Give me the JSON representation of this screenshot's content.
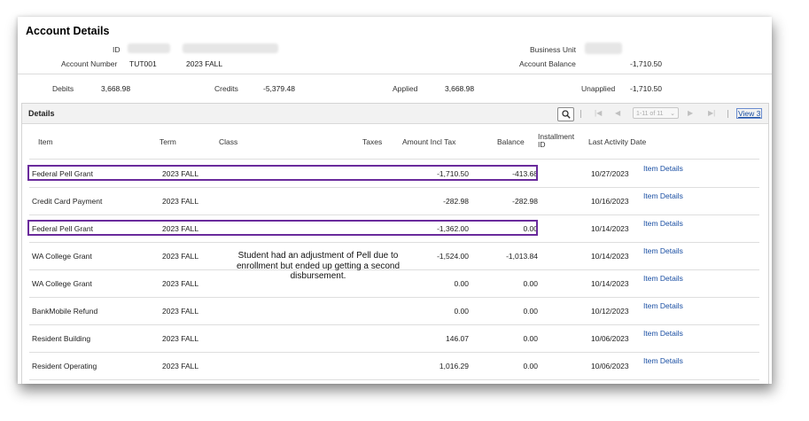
{
  "header": {
    "title": "Account Details",
    "id_label": "ID",
    "account_number_label": "Account Number",
    "account_number": "TUT001",
    "term": "2023 FALL",
    "business_unit_label": "Business Unit",
    "account_balance_label": "Account Balance",
    "account_balance": "-1,710.50"
  },
  "summary": {
    "debits_label": "Debits",
    "debits": "3,668.98",
    "credits_label": "Credits",
    "credits": "-5,379.48",
    "applied_label": "Applied",
    "applied": "3,668.98",
    "unapplied_label": "Unapplied",
    "unapplied": "-1,710.50"
  },
  "details": {
    "title": "Details",
    "pager": "1-11 of 11",
    "view_link": "View 3",
    "columns": {
      "item": "Item",
      "term": "Term",
      "class": "Class",
      "taxes": "Taxes",
      "amount": "Amount Incl Tax",
      "balance": "Balance",
      "installment_1": "Installment",
      "installment_2": "ID",
      "last_activity": "Last Activity Date"
    },
    "rows": [
      {
        "item": "Federal Pell Grant",
        "term": "2023 FALL",
        "amount": "-1,710.50",
        "balance": "-413.68",
        "date": "10/27/2023",
        "link": "Item Details"
      },
      {
        "item": "Credit Card Payment",
        "term": "2023 FALL",
        "amount": "-282.98",
        "balance": "-282.98",
        "date": "10/16/2023",
        "link": "Item Details"
      },
      {
        "item": "Federal Pell Grant",
        "term": "2023 FALL",
        "amount": "-1,362.00",
        "balance": "0.00",
        "date": "10/14/2023",
        "link": "Item Details"
      },
      {
        "item": "WA College Grant",
        "term": "2023 FALL",
        "amount": "-1,524.00",
        "balance": "-1,013.84",
        "date": "10/14/2023",
        "link": "Item Details"
      },
      {
        "item": "WA College Grant",
        "term": "2023 FALL",
        "amount": "0.00",
        "balance": "0.00",
        "date": "10/14/2023",
        "link": "Item Details"
      },
      {
        "item": "BankMobile Refund",
        "term": "2023 FALL",
        "amount": "0.00",
        "balance": "0.00",
        "date": "10/12/2023",
        "link": "Item Details"
      },
      {
        "item": "Resident Building",
        "term": "2023 FALL",
        "amount": "146.07",
        "balance": "0.00",
        "date": "10/06/2023",
        "link": "Item Details"
      },
      {
        "item": "Resident Operating",
        "term": "2023 FALL",
        "amount": "1,016.29",
        "balance": "0.00",
        "date": "10/06/2023",
        "link": "Item Details"
      }
    ]
  },
  "annotation": {
    "text": "Student had an adjustment of Pell due to enrollment but ended up getting a second disbursement.",
    "highlight_color": "#6a2b9c"
  },
  "colors": {
    "link": "#1a4fa3",
    "header_bg": "#f2f2f2"
  }
}
